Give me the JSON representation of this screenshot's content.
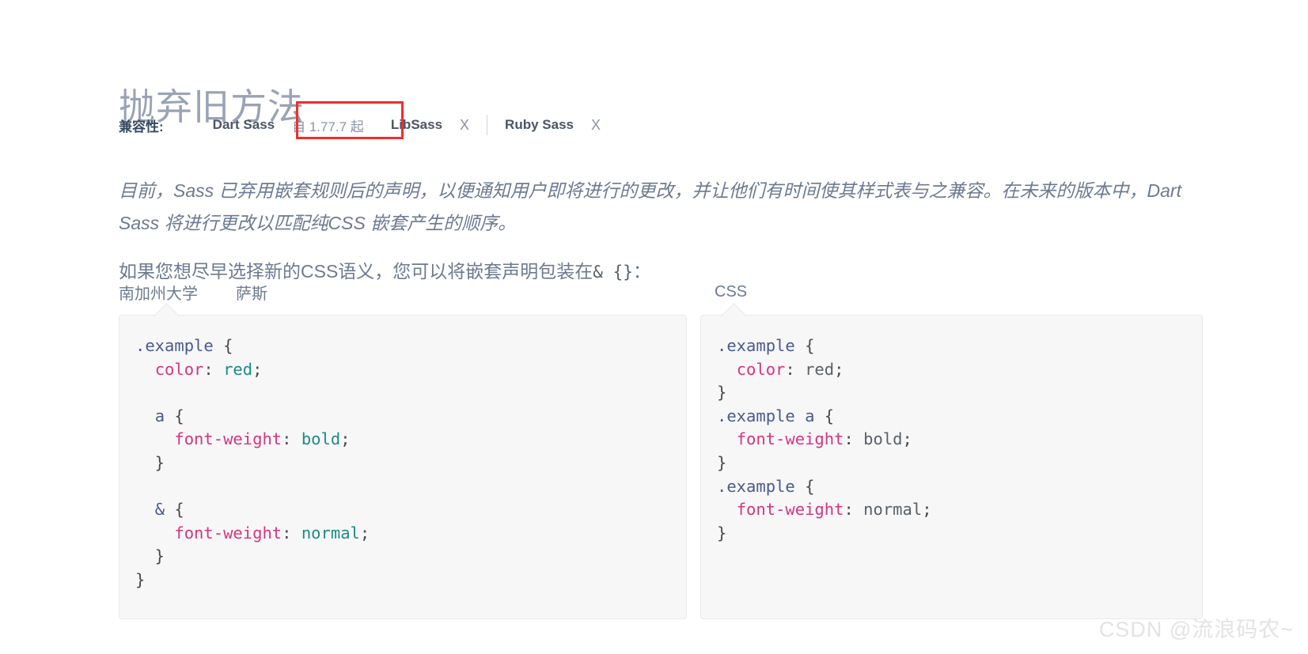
{
  "page": {
    "title": "抛弃旧方法"
  },
  "compatibility": {
    "label": "兼容性:",
    "items": [
      {
        "name": "Dart Sass",
        "status": "自 1.77.7 起",
        "highlighted": true
      },
      {
        "name": "LibSass",
        "status": "X",
        "highlighted": false
      },
      {
        "name": "Ruby Sass",
        "status": "X",
        "highlighted": false
      }
    ]
  },
  "paragraphs": {
    "intro": "目前，Sass 已弃用嵌套规则后的声明，以便通知用户即将进行的更改，并让他们有时间使其样式表与之兼容。在未来的版本中，Dart Sass 将进行更改以匹配纯CSS 嵌套产生的顺序。",
    "second_before": "如果您想尽早选择新的CSS语义，您可以将嵌套声明包装在",
    "second_code": "& {}",
    "second_after": "："
  },
  "examples": {
    "left": {
      "tabs": [
        {
          "label": "南加州大学",
          "active": false
        },
        {
          "label": "萨斯",
          "active": true
        }
      ],
      "code_lines": [
        [
          {
            "t": ".example",
            "c": "sel"
          },
          {
            "t": " {",
            "c": "punc"
          }
        ],
        [
          {
            "t": "  ",
            "c": "punc"
          },
          {
            "t": "color",
            "c": "prop"
          },
          {
            "t": ": ",
            "c": "punc"
          },
          {
            "t": "red",
            "c": "val"
          },
          {
            "t": ";",
            "c": "punc"
          }
        ],
        [
          {
            "t": "",
            "c": "punc"
          }
        ],
        [
          {
            "t": "  ",
            "c": "punc"
          },
          {
            "t": "a",
            "c": "sel"
          },
          {
            "t": " {",
            "c": "punc"
          }
        ],
        [
          {
            "t": "    ",
            "c": "punc"
          },
          {
            "t": "font-weight",
            "c": "prop"
          },
          {
            "t": ": ",
            "c": "punc"
          },
          {
            "t": "bold",
            "c": "val"
          },
          {
            "t": ";",
            "c": "punc"
          }
        ],
        [
          {
            "t": "  }",
            "c": "punc"
          }
        ],
        [
          {
            "t": "",
            "c": "punc"
          }
        ],
        [
          {
            "t": "  ",
            "c": "punc"
          },
          {
            "t": "&",
            "c": "sel"
          },
          {
            "t": " {",
            "c": "punc"
          }
        ],
        [
          {
            "t": "    ",
            "c": "punc"
          },
          {
            "t": "font-weight",
            "c": "prop"
          },
          {
            "t": ": ",
            "c": "punc"
          },
          {
            "t": "normal",
            "c": "val"
          },
          {
            "t": ";",
            "c": "punc"
          }
        ],
        [
          {
            "t": "  }",
            "c": "punc"
          }
        ],
        [
          {
            "t": "}",
            "c": "punc"
          }
        ]
      ]
    },
    "right": {
      "tabs": [
        {
          "label": "CSS",
          "active": false
        }
      ],
      "code_lines": [
        [
          {
            "t": ".example",
            "c": "sel"
          },
          {
            "t": " {",
            "c": "punc"
          }
        ],
        [
          {
            "t": "  ",
            "c": "punc"
          },
          {
            "t": "color",
            "c": "prop"
          },
          {
            "t": ": ",
            "c": "punc"
          },
          {
            "t": "red",
            "c": "val-plain"
          },
          {
            "t": ";",
            "c": "punc"
          }
        ],
        [
          {
            "t": "}",
            "c": "punc"
          }
        ],
        [
          {
            "t": ".example a",
            "c": "sel"
          },
          {
            "t": " {",
            "c": "punc"
          }
        ],
        [
          {
            "t": "  ",
            "c": "punc"
          },
          {
            "t": "font-weight",
            "c": "prop"
          },
          {
            "t": ": ",
            "c": "punc"
          },
          {
            "t": "bold",
            "c": "val-plain"
          },
          {
            "t": ";",
            "c": "punc"
          }
        ],
        [
          {
            "t": "}",
            "c": "punc"
          }
        ],
        [
          {
            "t": ".example",
            "c": "sel"
          },
          {
            "t": " {",
            "c": "punc"
          }
        ],
        [
          {
            "t": "  ",
            "c": "punc"
          },
          {
            "t": "font-weight",
            "c": "prop"
          },
          {
            "t": ": ",
            "c": "punc"
          },
          {
            "t": "normal",
            "c": "val-plain"
          },
          {
            "t": ";",
            "c": "punc"
          }
        ],
        [
          {
            "t": "}",
            "c": "punc"
          }
        ]
      ]
    }
  },
  "watermark": {
    "text": "CSDN @流浪码农~"
  },
  "colors": {
    "title": "#9aa3b5",
    "body_text": "#6c7a91",
    "accent_pink": "#cd3f85",
    "annotation_red": "#f42c2c",
    "code_selector": "#4a5a8c",
    "code_property": "#d33682",
    "code_value": "#1d8a87",
    "code_bg": "#f7f7f7"
  }
}
